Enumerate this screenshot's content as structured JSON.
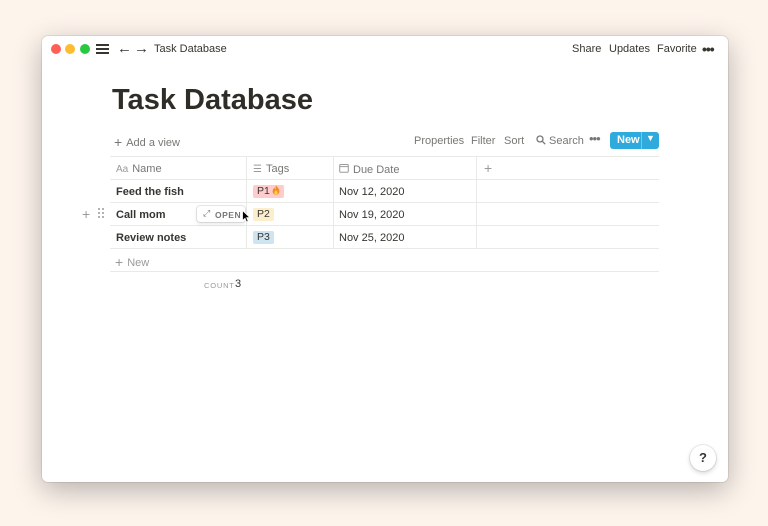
{
  "titlebar": {
    "breadcrumb_title": "Task Database",
    "share_label": "Share",
    "updates_label": "Updates",
    "favorite_label": "Favorite",
    "more_glyph": "•••"
  },
  "page": {
    "title": "Task Database"
  },
  "toolbar": {
    "add_view_label": "Add a view",
    "properties_label": "Properties",
    "filter_label": "Filter",
    "sort_label": "Sort",
    "search_label": "Search",
    "more_glyph": "•••",
    "new_label": "New"
  },
  "table": {
    "columns": [
      {
        "label": "Name",
        "icon": "text-property-icon"
      },
      {
        "label": "Tags",
        "icon": "list-property-icon"
      },
      {
        "label": "Due Date",
        "icon": "calendar-icon"
      }
    ],
    "rows": [
      {
        "name": "Feed the fish",
        "tag": "P1",
        "tag_emoji_icon": "fire-icon",
        "due": "Nov 12, 2020"
      },
      {
        "name": "Call mom",
        "tag": "P2",
        "due": "Nov 19, 2020"
      },
      {
        "name": "Review notes",
        "tag": "P3",
        "due": "Nov 25, 2020"
      }
    ],
    "open_label": "OPEN",
    "new_row_label": "New",
    "count_label": "COUNT",
    "count_value": "3"
  },
  "help": {
    "label": "?"
  },
  "colors": {
    "accent": "#2eaadc",
    "tag_p1": "#ffcccd",
    "tag_p2": "#fbeecc",
    "tag_p3": "#cfe4f1",
    "background": "#fdf4ec"
  }
}
